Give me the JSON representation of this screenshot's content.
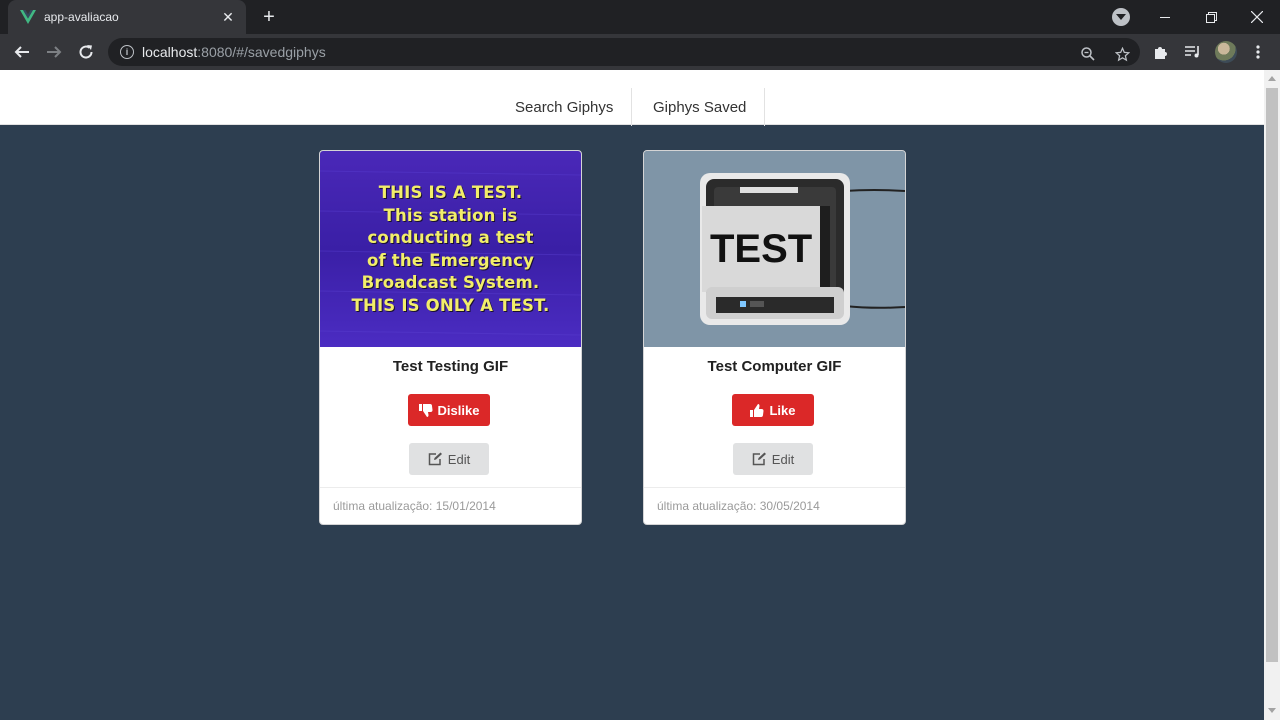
{
  "browser": {
    "tab_title": "app-avaliacao",
    "url_host": "localhost",
    "url_rest": ":8080/#/savedgiphys"
  },
  "nav": {
    "search_label": "Search Giphys",
    "saved_label": "Giphys Saved"
  },
  "cards": [
    {
      "title": "Test Testing GIF",
      "action_label": "Dislike",
      "action_icon": "thumbs-down-icon",
      "edit_label": "Edit",
      "footer": "última atualização: 15/01/2014",
      "image_text": [
        "THIS IS A TEST.",
        "This station is",
        "conducting a test",
        "of the Emergency",
        "Broadcast System.",
        "THIS IS ONLY A TEST."
      ]
    },
    {
      "title": "Test Computer GIF",
      "action_label": "Like",
      "action_icon": "thumbs-up-icon",
      "edit_label": "Edit",
      "footer": "última atualização: 30/05/2014",
      "image_text": [
        "TEST"
      ]
    }
  ],
  "colors": {
    "page_bg": "#2d3e50",
    "button_red": "#db2828",
    "button_grey": "#e0e1e2"
  }
}
